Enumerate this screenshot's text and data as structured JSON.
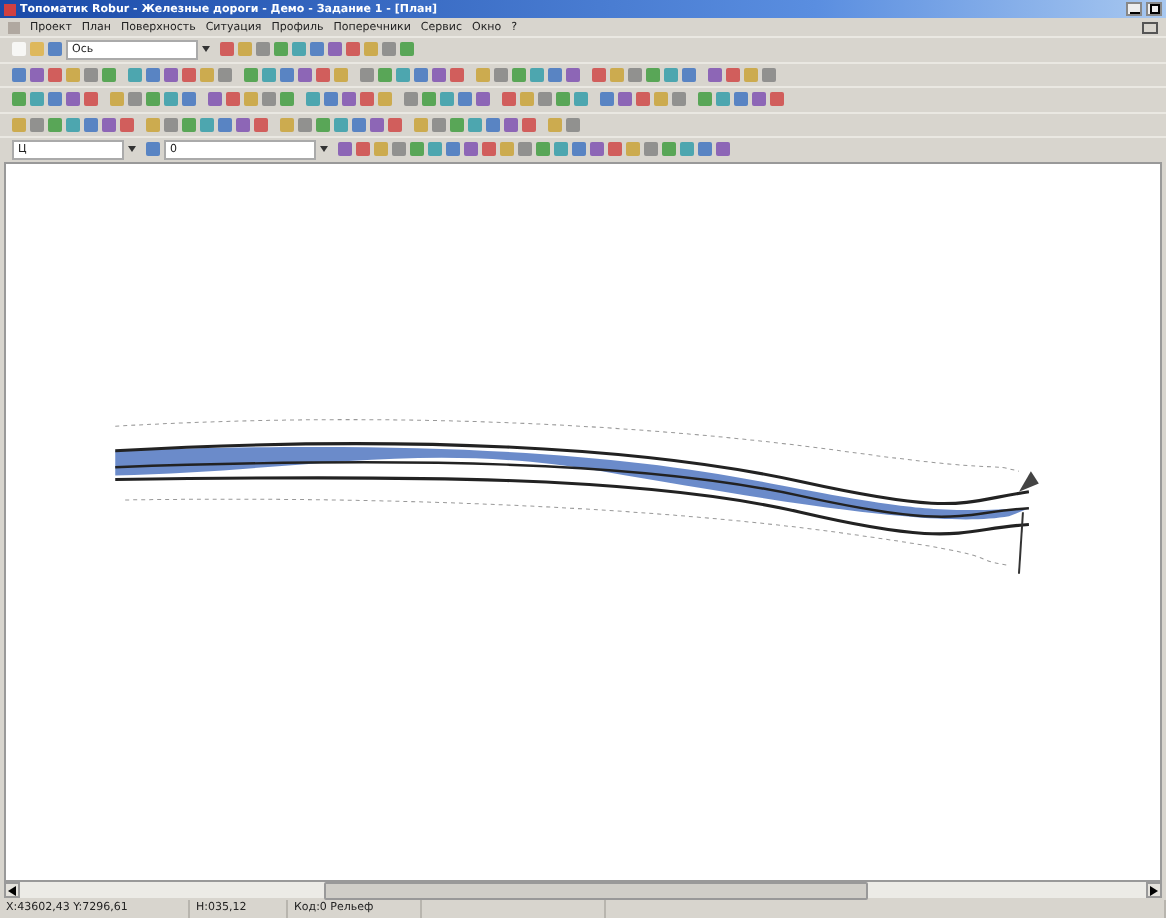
{
  "window": {
    "title": "Топоматик Robur - Железные дороги - Демо - Задание 1 - [План]"
  },
  "menu": [
    "Проект",
    "План",
    "Поверхность",
    "Ситуация",
    "Профиль",
    "Поперечники",
    "Сервис",
    "Окно",
    "?"
  ],
  "toolbar": {
    "object_combo": "Ось",
    "layer_combo": "Ц",
    "code_combo": "0"
  },
  "status_bar": [
    "X:43602,43  Y:7296,61",
    "H:035,12",
    "Код:0 Рельеф"
  ]
}
